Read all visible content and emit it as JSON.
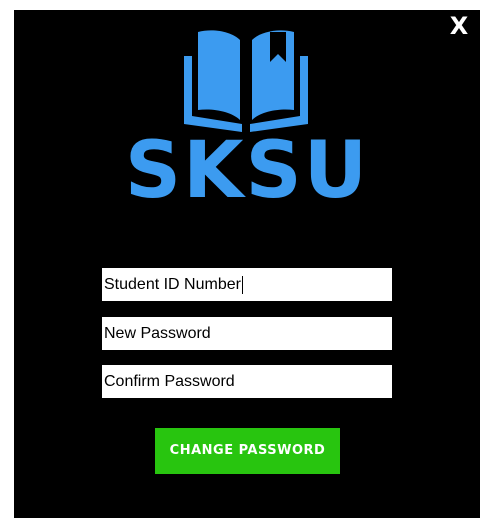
{
  "window": {
    "close_label": "X"
  },
  "logo": {
    "icon": "open-book-icon",
    "text": "SKSU",
    "color": "#3c9bf0"
  },
  "form": {
    "student_id": {
      "value": "Student ID Number",
      "has_focus": true
    },
    "new_password": {
      "value": "New Password"
    },
    "confirm_password": {
      "value": "Confirm Password"
    },
    "submit_label": "CHANGE PASSWORD",
    "submit_color": "#28c50f"
  }
}
